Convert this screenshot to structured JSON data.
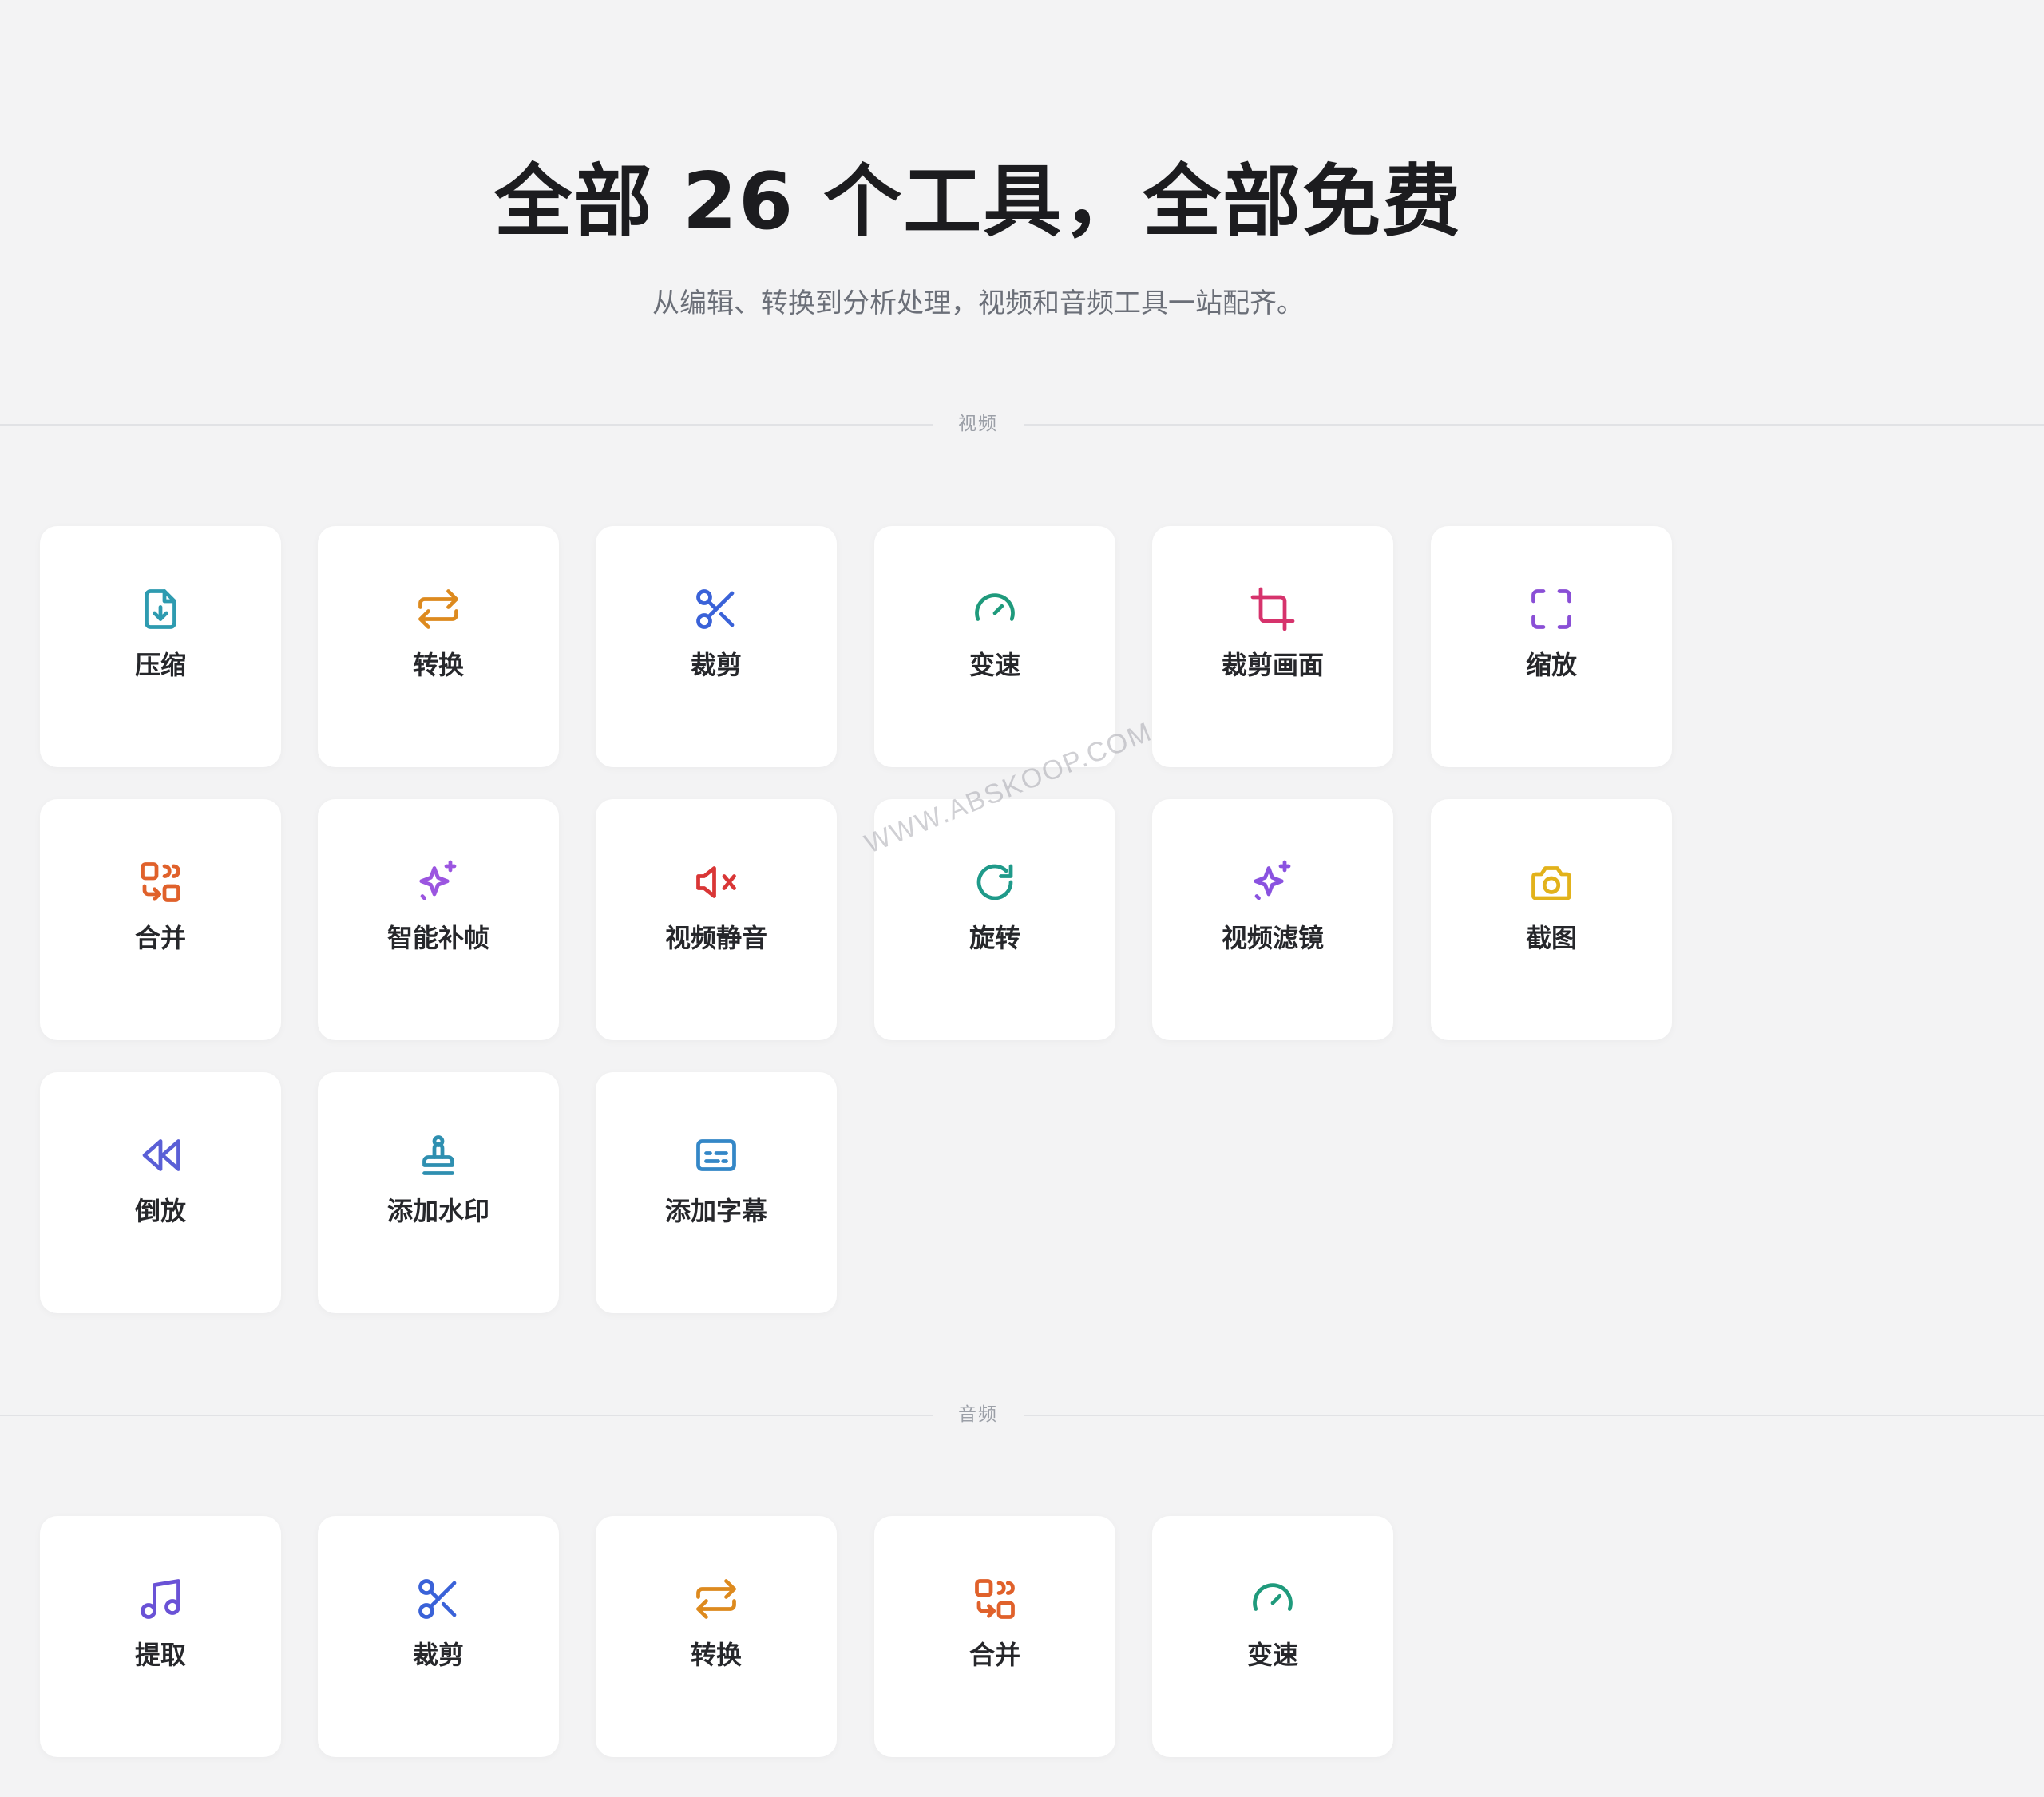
{
  "header": {
    "title": "全部 26 个工具，全部免费",
    "subtitle": "从编辑、转换到分析处理，视频和音频工具一站配齐。"
  },
  "watermark": "WWW.ABSKOOP.COM",
  "sections": {
    "video": {
      "label": "视频",
      "tools": [
        {
          "label": "压缩",
          "icon": "file-download-icon",
          "color": "#2e9bb0"
        },
        {
          "label": "转换",
          "icon": "arrows-repeat-icon",
          "color": "#dd8a1e"
        },
        {
          "label": "裁剪",
          "icon": "scissors-icon",
          "color": "#3a62d8"
        },
        {
          "label": "变速",
          "icon": "speedometer-icon",
          "color": "#1f9a7c"
        },
        {
          "label": "裁剪画面",
          "icon": "crop-icon",
          "color": "#d6336c"
        },
        {
          "label": "缩放",
          "icon": "fullscreen-icon",
          "color": "#8a4fd6"
        },
        {
          "label": "合并",
          "icon": "merge-icon",
          "color": "#e0612b"
        },
        {
          "label": "智能补帧",
          "icon": "sparkles-icon",
          "color": "#9b55e0"
        },
        {
          "label": "视频静音",
          "icon": "volume-mute-icon",
          "color": "#d93636"
        },
        {
          "label": "旋转",
          "icon": "rotate-icon",
          "color": "#1f9a8a"
        },
        {
          "label": "视频滤镜",
          "icon": "sparkles-icon",
          "color": "#8a52e0"
        },
        {
          "label": "截图",
          "icon": "camera-icon",
          "color": "#e2b21b"
        },
        {
          "label": "倒放",
          "icon": "rewind-icon",
          "color": "#5a5fd6"
        },
        {
          "label": "添加水印",
          "icon": "stamp-icon",
          "color": "#2e8fb0"
        },
        {
          "label": "添加字幕",
          "icon": "subtitles-icon",
          "color": "#3487c7"
        }
      ]
    },
    "audio": {
      "label": "音频",
      "tools": [
        {
          "label": "提取",
          "icon": "music-note-icon",
          "color": "#6a52d6"
        },
        {
          "label": "裁剪",
          "icon": "scissors-icon",
          "color": "#3a62d8"
        },
        {
          "label": "转换",
          "icon": "arrows-repeat-icon",
          "color": "#dd8a1e"
        },
        {
          "label": "合并",
          "icon": "merge-icon",
          "color": "#e0612b"
        },
        {
          "label": "变速",
          "icon": "speedometer-icon",
          "color": "#1f9a7c"
        }
      ]
    }
  }
}
